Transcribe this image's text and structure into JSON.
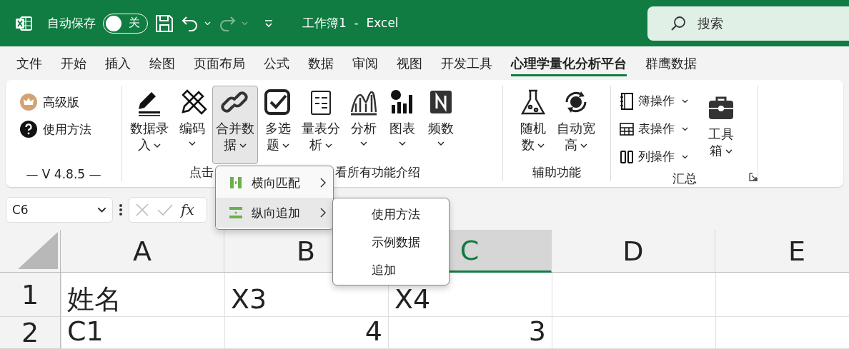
{
  "title_bar": {
    "autosave_label": "自动保存",
    "autosave": {
      "on": false,
      "label": "关"
    },
    "redo_disabled": true,
    "title": "工作簿1  -  Excel",
    "search": {
      "placeholder": "搜索"
    }
  },
  "tabs": [
    {
      "label": "文件",
      "selected": false
    },
    {
      "label": "开始",
      "selected": false
    },
    {
      "label": "插入",
      "selected": false
    },
    {
      "label": "绘图",
      "selected": false
    },
    {
      "label": "页面布局",
      "selected": false
    },
    {
      "label": "公式",
      "selected": false
    },
    {
      "label": "数据",
      "selected": false
    },
    {
      "label": "审阅",
      "selected": false
    },
    {
      "label": "视图",
      "selected": false
    },
    {
      "label": "开发工具",
      "selected": false
    },
    {
      "label": "心理学量化分析平台",
      "selected": true
    },
    {
      "label": "群鹰数据",
      "selected": false
    }
  ],
  "ribbon": {
    "left_items": [
      {
        "label": "高级版"
      },
      {
        "label": "使用方法"
      }
    ],
    "version": "— V 4.8.5 —",
    "main_buttons": [
      {
        "label": "数据录入",
        "pressed": false
      },
      {
        "label": "编码",
        "pressed": false
      },
      {
        "label": "合并数据",
        "pressed": true
      },
      {
        "label": "多选题",
        "pressed": false
      },
      {
        "label": "量表分析",
        "pressed": false
      },
      {
        "label": "分析",
        "pressed": false
      },
      {
        "label": "图表",
        "pressed": false
      },
      {
        "label": "频数",
        "pressed": false
      }
    ],
    "main_label_left": "点击",
    "main_label_right": "看所有功能介绍",
    "aux_buttons": [
      {
        "label": "随机数",
        "pressed": false
      },
      {
        "label": "自动宽高",
        "pressed": false
      }
    ],
    "aux_label": "辅助功能",
    "summary_items": [
      {
        "label": "簿操作"
      },
      {
        "label": "表操作"
      },
      {
        "label": "列操作"
      }
    ],
    "toolbox": {
      "label": "工具箱",
      "pressed": false
    },
    "summary_label": "汇总"
  },
  "formula_bar": {
    "name_box": "C6",
    "fx_label": "fx"
  },
  "sheet": {
    "columns": [
      {
        "label": "A",
        "selected": false
      },
      {
        "label": "B",
        "selected": false
      },
      {
        "label": "C",
        "selected": true
      },
      {
        "label": "D",
        "selected": false
      },
      {
        "label": "E",
        "selected": false
      }
    ],
    "rows": [
      {
        "label": "1",
        "cells": [
          {
            "text": "姓名",
            "kind": "text"
          },
          {
            "text": "X3",
            "kind": "text"
          },
          {
            "text": "X4",
            "kind": "text"
          },
          {
            "kind": "empty"
          },
          {
            "kind": "empty"
          }
        ]
      },
      {
        "label": "2",
        "cells": [
          {
            "text": "C1",
            "kind": "text"
          },
          {
            "text": "4",
            "kind": "number"
          },
          {
            "text": "3",
            "kind": "number"
          },
          {
            "kind": "empty"
          },
          {
            "kind": "empty"
          }
        ]
      }
    ]
  },
  "menu": {
    "items": [
      {
        "label": "横向匹配",
        "selected": false
      },
      {
        "label": "纵向追加",
        "selected": true
      }
    ]
  },
  "submenu": {
    "items": [
      {
        "label": "使用方法"
      },
      {
        "label": "示例数据"
      },
      {
        "label": "追加"
      }
    ]
  }
}
